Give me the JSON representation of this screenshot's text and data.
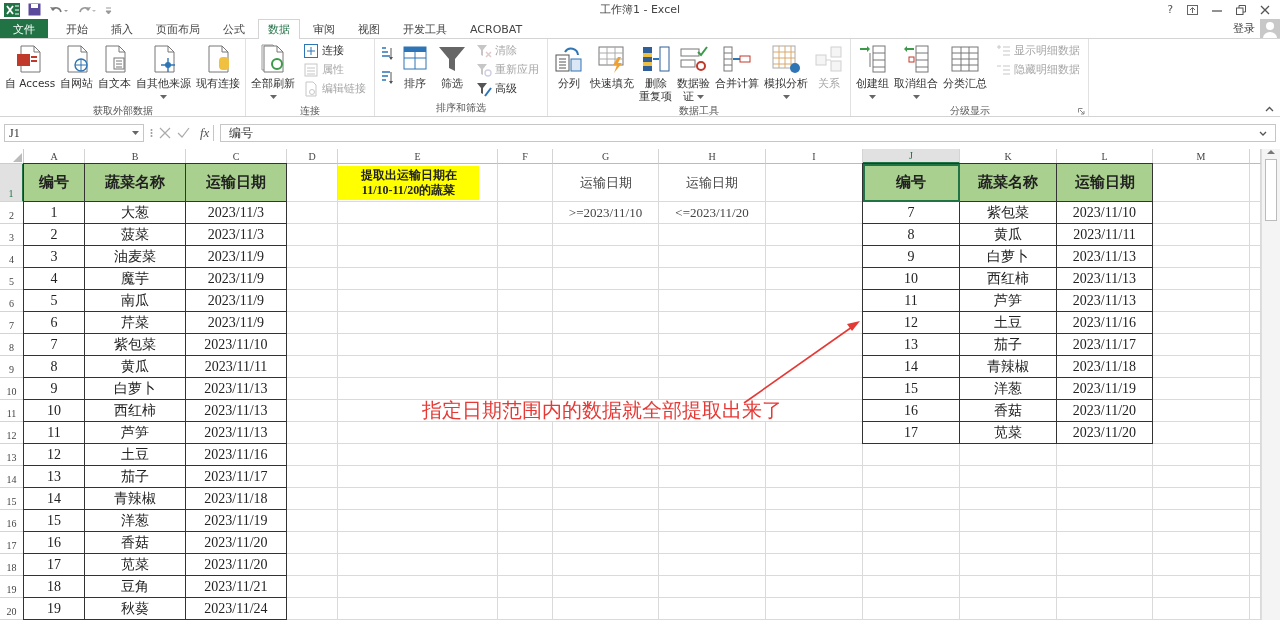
{
  "title_bar": {
    "title": "工作簿1 - Excel",
    "help": "?"
  },
  "tabs": [
    {
      "label": "文件",
      "kind": "file",
      "selected": false
    },
    {
      "label": "开始",
      "kind": "tab",
      "selected": false
    },
    {
      "label": "插入",
      "kind": "tab",
      "selected": false
    },
    {
      "label": "页面布局",
      "kind": "tab",
      "selected": false
    },
    {
      "label": "公式",
      "kind": "tab",
      "selected": false
    },
    {
      "label": "数据",
      "kind": "tab",
      "selected": true
    },
    {
      "label": "审阅",
      "kind": "tab",
      "selected": false
    },
    {
      "label": "视图",
      "kind": "tab",
      "selected": false
    },
    {
      "label": "开发工具",
      "kind": "tab",
      "selected": false
    },
    {
      "label": "ACROBAT",
      "kind": "tab",
      "selected": false
    }
  ],
  "account": {
    "label": "登录"
  },
  "ribbon": {
    "groups": [
      {
        "label": "获取外部数据",
        "launcher": false,
        "items": [
          {
            "kind": "large",
            "lines": [
              "自 Access"
            ],
            "dropdown": false,
            "disabled": false
          },
          {
            "kind": "large",
            "lines": [
              "自网站"
            ],
            "dropdown": false,
            "disabled": false
          },
          {
            "kind": "large",
            "lines": [
              "自文本"
            ],
            "dropdown": false,
            "disabled": false
          },
          {
            "kind": "large",
            "lines": [
              "自其他来源"
            ],
            "dropdown": true,
            "disabled": false
          },
          {
            "kind": "large",
            "lines": [
              "现有连接"
            ],
            "dropdown": false,
            "disabled": false
          }
        ]
      },
      {
        "label": "连接",
        "launcher": false,
        "items": [
          {
            "kind": "large",
            "lines": [
              "全部刷新"
            ],
            "dropdown": true,
            "disabled": false
          },
          {
            "kind": "stack",
            "buttons": [
              {
                "label": "连接",
                "disabled": false
              },
              {
                "label": "属性",
                "disabled": true
              },
              {
                "label": "编辑链接",
                "disabled": true
              }
            ]
          }
        ]
      },
      {
        "label": "排序和筛选",
        "launcher": false,
        "items": [
          {
            "kind": "sort-icons"
          },
          {
            "kind": "large",
            "lines": [
              "排序"
            ],
            "dropdown": false,
            "disabled": false
          },
          {
            "kind": "large",
            "lines": [
              "筛选"
            ],
            "dropdown": false,
            "disabled": false
          },
          {
            "kind": "stack",
            "buttons": [
              {
                "label": "清除",
                "disabled": true
              },
              {
                "label": "重新应用",
                "disabled": true
              },
              {
                "label": "高级",
                "disabled": false
              }
            ]
          }
        ]
      },
      {
        "label": "数据工具",
        "launcher": false,
        "items": [
          {
            "kind": "large",
            "lines": [
              "分列"
            ],
            "dropdown": false,
            "disabled": false
          },
          {
            "kind": "large",
            "lines": [
              "快速填充"
            ],
            "dropdown": false,
            "disabled": false
          },
          {
            "kind": "large",
            "lines": [
              "删除",
              "重复项"
            ],
            "dropdown": false,
            "disabled": false
          },
          {
            "kind": "large",
            "lines": [
              "数据验",
              "证"
            ],
            "dropdown": true,
            "disabled": false
          },
          {
            "kind": "large",
            "lines": [
              "合并计算"
            ],
            "dropdown": false,
            "disabled": false
          },
          {
            "kind": "large",
            "lines": [
              "模拟分析"
            ],
            "dropdown": true,
            "disabled": false
          },
          {
            "kind": "large",
            "lines": [
              "关系"
            ],
            "dropdown": false,
            "disabled": true
          }
        ]
      },
      {
        "label": "分级显示",
        "launcher": true,
        "items": [
          {
            "kind": "large",
            "lines": [
              "创建组"
            ],
            "dropdown": true,
            "disabled": false
          },
          {
            "kind": "large",
            "lines": [
              "取消组合"
            ],
            "dropdown": true,
            "disabled": false
          },
          {
            "kind": "large",
            "lines": [
              "分类汇总"
            ],
            "dropdown": false,
            "disabled": false
          },
          {
            "kind": "stack",
            "buttons": [
              {
                "label": "显示明细数据",
                "disabled": true
              },
              {
                "label": "隐藏明细数据",
                "disabled": true
              }
            ]
          }
        ]
      }
    ]
  },
  "formula_bar": {
    "name_box": "J1",
    "function_label": "fx",
    "formula": "编号"
  },
  "sheet": {
    "columns": [
      {
        "label": "A",
        "selected": false
      },
      {
        "label": "B",
        "selected": false
      },
      {
        "label": "C",
        "selected": false
      },
      {
        "label": "D",
        "selected": false
      },
      {
        "label": "E",
        "selected": false
      },
      {
        "label": "F",
        "selected": false
      },
      {
        "label": "G",
        "selected": false
      },
      {
        "label": "H",
        "selected": false
      },
      {
        "label": "I",
        "selected": false
      },
      {
        "label": "J",
        "selected": true
      },
      {
        "label": "K",
        "selected": false
      },
      {
        "label": "L",
        "selected": false
      },
      {
        "label": "M",
        "selected": false
      }
    ],
    "rows": [
      {
        "label": "1",
        "selected": true
      },
      {
        "label": "2",
        "selected": false
      },
      {
        "label": "3",
        "selected": false
      },
      {
        "label": "4",
        "selected": false
      },
      {
        "label": "5",
        "selected": false
      },
      {
        "label": "6",
        "selected": false
      },
      {
        "label": "7",
        "selected": false
      },
      {
        "label": "8",
        "selected": false
      },
      {
        "label": "9",
        "selected": false
      },
      {
        "label": "10",
        "selected": false
      },
      {
        "label": "11",
        "selected": false
      },
      {
        "label": "12",
        "selected": false
      },
      {
        "label": "13",
        "selected": false
      },
      {
        "label": "14",
        "selected": false
      },
      {
        "label": "15",
        "selected": false
      },
      {
        "label": "16",
        "selected": false
      },
      {
        "label": "17",
        "selected": false
      },
      {
        "label": "18",
        "selected": false
      },
      {
        "label": "19",
        "selected": false
      },
      {
        "label": "20",
        "selected": false
      }
    ],
    "source_table": {
      "header": [
        "编号",
        "蔬菜名称",
        "运输日期"
      ],
      "rows": [
        [
          "1",
          "大葱",
          "2023/11/3"
        ],
        [
          "2",
          "菠菜",
          "2023/11/3"
        ],
        [
          "3",
          "油麦菜",
          "2023/11/9"
        ],
        [
          "4",
          "魔芋",
          "2023/11/9"
        ],
        [
          "5",
          "南瓜",
          "2023/11/9"
        ],
        [
          "6",
          "芹菜",
          "2023/11/9"
        ],
        [
          "7",
          "紫包菜",
          "2023/11/10"
        ],
        [
          "8",
          "黄瓜",
          "2023/11/11"
        ],
        [
          "9",
          "白萝卜",
          "2023/11/13"
        ],
        [
          "10",
          "西红柿",
          "2023/11/13"
        ],
        [
          "11",
          "芦笋",
          "2023/11/13"
        ],
        [
          "12",
          "土豆",
          "2023/11/16"
        ],
        [
          "13",
          "茄子",
          "2023/11/17"
        ],
        [
          "14",
          "青辣椒",
          "2023/11/18"
        ],
        [
          "15",
          "洋葱",
          "2023/11/19"
        ],
        [
          "16",
          "香菇",
          "2023/11/20"
        ],
        [
          "17",
          "苋菜",
          "2023/11/20"
        ],
        [
          "18",
          "豆角",
          "2023/11/21"
        ],
        [
          "19",
          "秋葵",
          "2023/11/24"
        ]
      ]
    },
    "note": {
      "lines": [
        "提取出运输日期在",
        "11/10-11/20的蔬菜"
      ]
    },
    "criteria": {
      "header": [
        "运输日期",
        "运输日期"
      ],
      "values": [
        ">=2023/11/10",
        "<=2023/11/20"
      ]
    },
    "result_table": {
      "header": [
        "编号",
        "蔬菜名称",
        "运输日期"
      ],
      "rows": [
        [
          "7",
          "紫包菜",
          "2023/11/10"
        ],
        [
          "8",
          "黄瓜",
          "2023/11/11"
        ],
        [
          "9",
          "白萝卜",
          "2023/11/13"
        ],
        [
          "10",
          "西红柿",
          "2023/11/13"
        ],
        [
          "11",
          "芦笋",
          "2023/11/13"
        ],
        [
          "12",
          "土豆",
          "2023/11/16"
        ],
        [
          "13",
          "茄子",
          "2023/11/17"
        ],
        [
          "14",
          "青辣椒",
          "2023/11/18"
        ],
        [
          "15",
          "洋葱",
          "2023/11/19"
        ],
        [
          "16",
          "香菇",
          "2023/11/20"
        ],
        [
          "17",
          "苋菜",
          "2023/11/20"
        ]
      ]
    },
    "annotation": {
      "text": "指定日期范围内的数据就全部提取出来了"
    }
  }
}
